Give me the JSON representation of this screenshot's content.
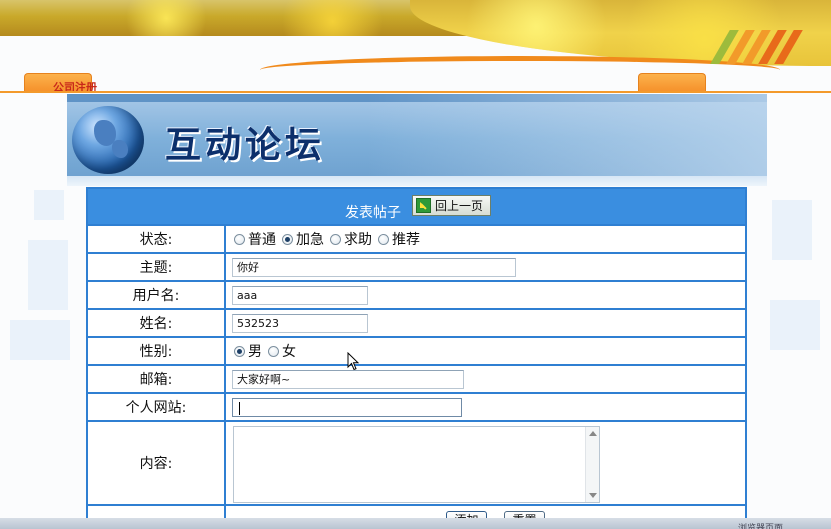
{
  "top_nav": {
    "left_tab_label": "公司注册",
    "right_tab_label": ""
  },
  "forum": {
    "title": "互动论坛"
  },
  "form": {
    "heading": "发表帖子",
    "back_button_label": "回上一页",
    "rows": {
      "status": {
        "label": "状态:",
        "options": [
          {
            "label": "普通",
            "checked": false
          },
          {
            "label": "加急",
            "checked": true
          },
          {
            "label": "求助",
            "checked": false
          },
          {
            "label": "推荐",
            "checked": false
          }
        ]
      },
      "subject": {
        "label": "主题:",
        "value": "你好"
      },
      "username": {
        "label": "用户名:",
        "value": "aaa"
      },
      "name": {
        "label": "姓名:",
        "value": "532523"
      },
      "gender": {
        "label": "性别:",
        "options": [
          {
            "label": "男",
            "checked": true
          },
          {
            "label": "女",
            "checked": false
          }
        ]
      },
      "email": {
        "label": "邮箱:",
        "value": "大家好啊~"
      },
      "website": {
        "label": "个人网站:",
        "value": ""
      },
      "content": {
        "label": "内容:",
        "value": ""
      }
    },
    "submit_label": "添加",
    "reset_label": "重置"
  },
  "taskbar": {
    "item_label": "浏览器页面"
  },
  "colors": {
    "table_border": "#2f7fd2",
    "table_header": "#3a8ee0",
    "accent_orange": "#f39a2c",
    "tab_label_red": "#c8281a",
    "title_navy": "#0c2f6b"
  },
  "icons": [
    "back-arrow-icon",
    "globe-icon",
    "mouse-pointer-icon"
  ]
}
